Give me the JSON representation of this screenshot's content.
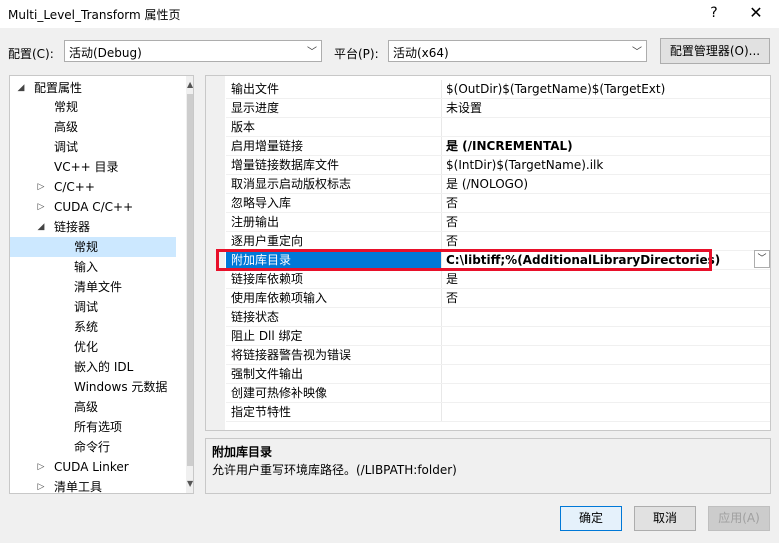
{
  "window": {
    "title": "Multi_Level_Transform 属性页",
    "help_glyph": "?",
    "close_glyph": "✕"
  },
  "toolbar": {
    "config_label": "配置(C):",
    "config_value": "活动(Debug)",
    "platform_label": "平台(P):",
    "platform_value": "活动(x64)",
    "config_manager_label": "配置管理器(O)..."
  },
  "tree": {
    "items": [
      {
        "label": "配置属性",
        "expander": "◢"
      },
      {
        "label": "常规",
        "expander": ""
      },
      {
        "label": "高级",
        "expander": ""
      },
      {
        "label": "调试",
        "expander": ""
      },
      {
        "label": "VC++ 目录",
        "expander": ""
      },
      {
        "label": "C/C++",
        "expander": "▷"
      },
      {
        "label": "CUDA C/C++",
        "expander": "▷"
      },
      {
        "label": "链接器",
        "expander": "◢"
      },
      {
        "label": "常规",
        "expander": ""
      },
      {
        "label": "输入",
        "expander": ""
      },
      {
        "label": "清单文件",
        "expander": ""
      },
      {
        "label": "调试",
        "expander": ""
      },
      {
        "label": "系统",
        "expander": ""
      },
      {
        "label": "优化",
        "expander": ""
      },
      {
        "label": "嵌入的 IDL",
        "expander": ""
      },
      {
        "label": "Windows 元数据",
        "expander": ""
      },
      {
        "label": "高级",
        "expander": ""
      },
      {
        "label": "所有选项",
        "expander": ""
      },
      {
        "label": "命令行",
        "expander": ""
      },
      {
        "label": "CUDA Linker",
        "expander": "▷"
      },
      {
        "label": "清单工具",
        "expander": "▷"
      }
    ]
  },
  "grid": {
    "rows": [
      {
        "name": "输出文件",
        "value": "$(OutDir)$(TargetName)$(TargetExt)"
      },
      {
        "name": "显示进度",
        "value": "未设置"
      },
      {
        "name": "版本",
        "value": ""
      },
      {
        "name": "启用增量链接",
        "value": "是 (/INCREMENTAL)"
      },
      {
        "name": "增量链接数据库文件",
        "value": "$(IntDir)$(TargetName).ilk"
      },
      {
        "name": "取消显示启动版权标志",
        "value": "是 (/NOLOGO)"
      },
      {
        "name": "忽略导入库",
        "value": "否"
      },
      {
        "name": "注册输出",
        "value": "否"
      },
      {
        "name": "逐用户重定向",
        "value": "否"
      },
      {
        "name": "附加库目录",
        "value": "C:\\libtiff;%(AdditionalLibraryDirectories)"
      },
      {
        "name": "链接库依赖项",
        "value": "是"
      },
      {
        "name": "使用库依赖项输入",
        "value": "否"
      },
      {
        "name": "链接状态",
        "value": ""
      },
      {
        "name": "阻止 Dll 绑定",
        "value": ""
      },
      {
        "name": "将链接器警告视为错误",
        "value": ""
      },
      {
        "name": "强制文件输出",
        "value": ""
      },
      {
        "name": "创建可热修补映像",
        "value": ""
      },
      {
        "name": "指定节特性",
        "value": ""
      }
    ],
    "dropdown_glyph": "﹀"
  },
  "description": {
    "title": "附加库目录",
    "text": "允许用户重写环境库路径。(/LIBPATH:folder)"
  },
  "buttons": {
    "ok": "确定",
    "cancel": "取消",
    "apply": "应用(A)"
  },
  "colors": {
    "selection_blue": "#0078d7",
    "tree_selection": "#cce8ff",
    "highlight_red": "#e8102a"
  }
}
